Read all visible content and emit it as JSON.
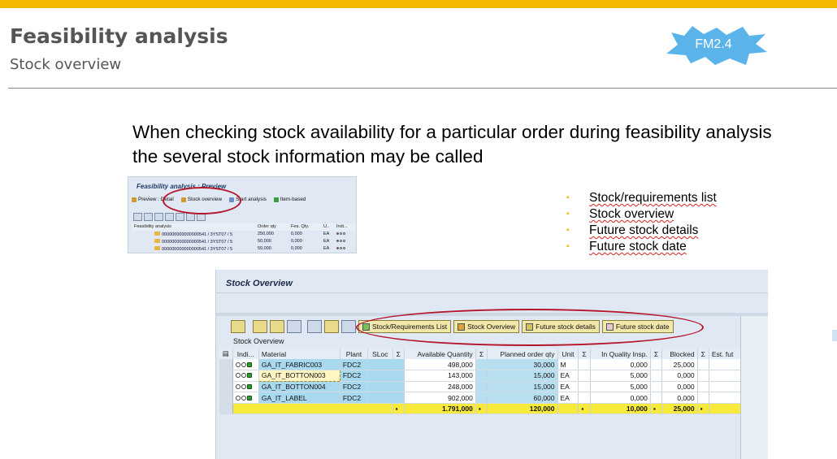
{
  "slide": {
    "title": "Feasibility analysis",
    "subtitle": "Stock overview",
    "badge": "FM2.4",
    "intro": "When checking stock availability for a particular order during feasibility analysis the several stock information may be called",
    "bullets": [
      "Stock/requirements list",
      "Stock overview",
      "Future stock details",
      "Future stock date"
    ]
  },
  "preview": {
    "title": "Feasibility analysis : Preview",
    "toolbar": [
      "Preview : Detail",
      "Stock overview",
      "Start analysis",
      "Item-based"
    ],
    "headers": [
      "Feasibility analysis",
      "Order qty",
      "Fea. Qty.",
      "U..",
      "Indi..."
    ],
    "rows": [
      {
        "item": "000000000000000541 / 3YST07 / 5",
        "order_qty": "250,000",
        "fea_qty": "0,000",
        "unit": "EA"
      },
      {
        "item": "000000000000000541 / 3YST07 / 5",
        "order_qty": "50,000",
        "fea_qty": "0,000",
        "unit": "EA"
      },
      {
        "item": "000000000000000541 / 3YST07 / 5",
        "order_qty": "50,000",
        "fea_qty": "0,000",
        "unit": "EA"
      }
    ]
  },
  "stock_overview": {
    "title": "Stock Overview",
    "caption": "Stock Overview",
    "buttons": [
      "Stock/Requirements List",
      "Stock Overview",
      "Future stock details",
      "Future stock date"
    ],
    "headers": [
      "Indi...",
      "Material",
      "Plant",
      "SLoc",
      "Σ",
      "Available Quantity",
      "Σ",
      "Planned order qty",
      "Unit",
      "Σ",
      "In Quality Insp.",
      "Σ",
      "Blocked",
      "Σ",
      "Est. fut"
    ],
    "rows": [
      {
        "material": "GA_IT_FABRIC003",
        "plant": "FDC2",
        "available": "498,000",
        "planned": "30,000",
        "unit": "M",
        "quality": "0,000",
        "blocked": "25,000"
      },
      {
        "material": "GA_IT_BOTTON003",
        "plant": "FDC2",
        "available": "143,000",
        "planned": "15,000",
        "unit": "EA",
        "quality": "5,000",
        "blocked": "0,000"
      },
      {
        "material": "GA_IT_BOTTON004",
        "plant": "FDC2",
        "available": "248,000",
        "planned": "15,000",
        "unit": "EA",
        "quality": "5,000",
        "blocked": "0,000"
      },
      {
        "material": "GA_IT_LABEL",
        "plant": "FDC2",
        "available": "902,000",
        "planned": "60,000",
        "unit": "EA",
        "quality": "0,000",
        "blocked": "0,000"
      }
    ],
    "totals": {
      "mark": "▪",
      "available": "1.791,000",
      "planned": "120,000",
      "quality": "10,000",
      "blocked": "25,000"
    }
  },
  "colors": {
    "accent": "#f5b800",
    "badge": "#5ab4ea",
    "circle": "#b5152a",
    "total_row": "#f7ea3a"
  }
}
